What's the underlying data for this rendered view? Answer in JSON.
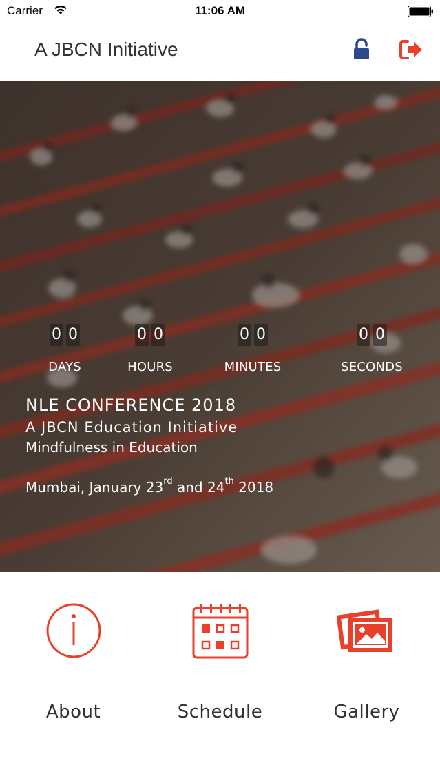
{
  "status_bar": {
    "carrier": "Carrier",
    "time": "11:06 AM",
    "wifi_icon": "wifi-icon",
    "battery_icon": "battery-icon"
  },
  "header": {
    "title": "A JBCN Initiative",
    "lock_icon": "unlock-icon",
    "logout_icon": "sign-out-icon",
    "colors": {
      "lock": "#2a4a8a",
      "logout": "#e8402a"
    }
  },
  "countdown": {
    "days": {
      "digits": [
        "0",
        "0"
      ],
      "label": "DAYS"
    },
    "hours": {
      "digits": [
        "0",
        "0"
      ],
      "label": "HOURS"
    },
    "minutes": {
      "digits": [
        "0",
        "0"
      ],
      "label": "MINUTES"
    },
    "seconds": {
      "digits": [
        "0",
        "0"
      ],
      "label": "SECONDS"
    }
  },
  "event": {
    "title": "NLE CONFERENCE 2018",
    "subtitle": "A JBCN Education Initiative",
    "theme": "Mindfulness in Education",
    "date_prefix": "Mumbai, January 23",
    "date_sup1": "rd",
    "date_mid": " and 24",
    "date_sup2": "th",
    "date_suffix": " 2018"
  },
  "menu": {
    "accent_color": "#e8402a",
    "items": [
      {
        "label": "About",
        "icon": "info-icon"
      },
      {
        "label": "Schedule",
        "icon": "calendar-icon"
      },
      {
        "label": "Gallery",
        "icon": "gallery-icon"
      }
    ]
  }
}
